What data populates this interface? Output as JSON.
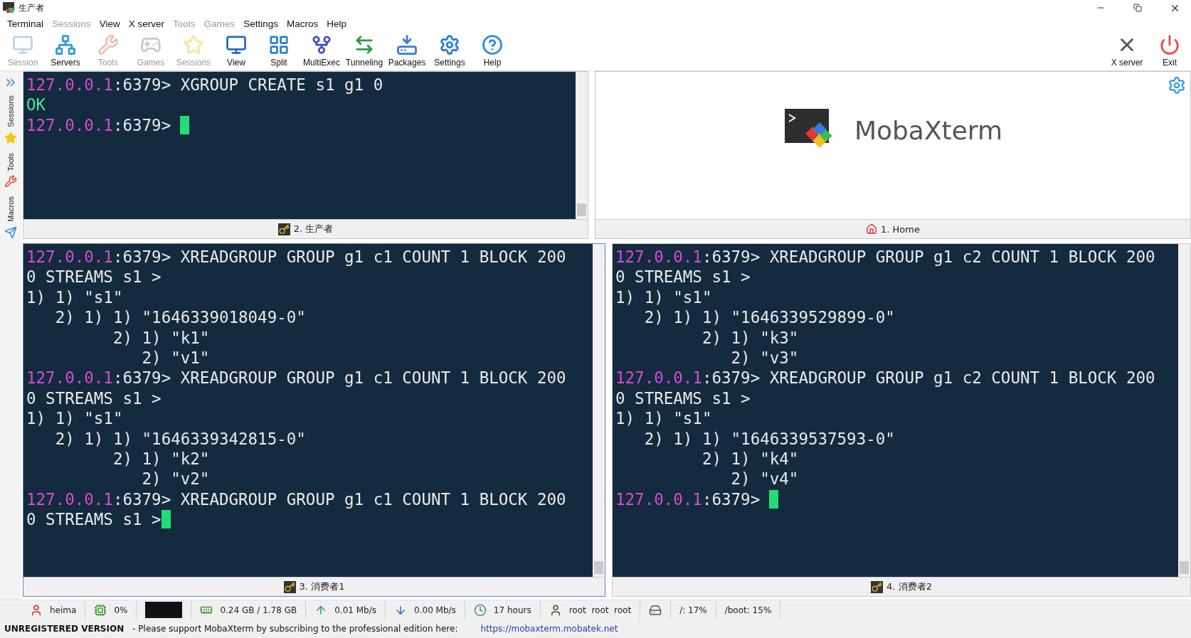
{
  "window": {
    "title": "生产者"
  },
  "menu": [
    {
      "label": "Terminal",
      "disabled": false
    },
    {
      "label": "Sessions",
      "disabled": true
    },
    {
      "label": "View",
      "disabled": false
    },
    {
      "label": "X server",
      "disabled": false
    },
    {
      "label": "Tools",
      "disabled": true
    },
    {
      "label": "Games",
      "disabled": true
    },
    {
      "label": "Settings",
      "disabled": false
    },
    {
      "label": "Macros",
      "disabled": false
    },
    {
      "label": "Help",
      "disabled": false
    }
  ],
  "toolbar": [
    {
      "kind": "session",
      "label": "Session",
      "disabled": true
    },
    {
      "kind": "servers",
      "label": "Servers",
      "disabled": false
    },
    {
      "kind": "tools",
      "label": "Tools",
      "disabled": true
    },
    {
      "kind": "games",
      "label": "Games",
      "disabled": true
    },
    {
      "kind": "sessions",
      "label": "Sessions",
      "disabled": true
    },
    {
      "kind": "view",
      "label": "View",
      "disabled": false
    },
    {
      "kind": "split",
      "label": "Split",
      "disabled": false
    },
    {
      "kind": "multiexec",
      "label": "MultiExec",
      "disabled": false
    },
    {
      "kind": "tunneling",
      "label": "Tunneling",
      "disabled": false
    },
    {
      "kind": "packages",
      "label": "Packages",
      "disabled": false
    },
    {
      "kind": "settings",
      "label": "Settings",
      "disabled": false
    },
    {
      "kind": "help",
      "label": "Help",
      "disabled": false
    }
  ],
  "toolbar_right": [
    {
      "kind": "xserver",
      "label": "X server"
    },
    {
      "kind": "exit",
      "label": "Exit"
    }
  ],
  "sidebar": [
    {
      "kind": "sessions",
      "label": "Sessions"
    },
    {
      "kind": "tools",
      "label": "Tools"
    },
    {
      "kind": "macros",
      "label": "Macros"
    }
  ],
  "panes": [
    {
      "kind": "terminal",
      "tab": "2. 生产者",
      "focused": false,
      "lines": [
        {
          "kind": "prompt",
          "host": "127.0.0.1",
          "port": ":6379>",
          "text": " XGROUP CREATE s1 g1 0",
          "cursor": false
        },
        {
          "kind": "ok",
          "text": "OK"
        },
        {
          "kind": "prompt",
          "host": "127.0.0.1",
          "port": ":6379>",
          "cursor": true
        }
      ]
    },
    {
      "kind": "home",
      "tab": "1. Home",
      "focused": false,
      "brand": "MobaXterm"
    },
    {
      "kind": "terminal",
      "tab": "3. 消费者1",
      "focused": true,
      "lines": [
        {
          "kind": "prompt",
          "host": "127.0.0.1",
          "port": ":6379>",
          "text": " XREADGROUP GROUP g1 c1 COUNT 1 BLOCK 200",
          "cursor": false
        },
        {
          "kind": "text",
          "text": "0 STREAMS s1 >"
        },
        {
          "kind": "text",
          "text": "1) 1) \"s1\""
        },
        {
          "kind": "text",
          "text": "   2) 1) 1) \"1646339018049-0\""
        },
        {
          "kind": "text",
          "text": "         2) 1) \"k1\""
        },
        {
          "kind": "text",
          "text": "            2) \"v1\""
        },
        {
          "kind": "prompt",
          "host": "127.0.0.1",
          "port": ":6379>",
          "text": " XREADGROUP GROUP g1 c1 COUNT 1 BLOCK 200",
          "cursor": false
        },
        {
          "kind": "text",
          "text": "0 STREAMS s1 >"
        },
        {
          "kind": "text",
          "text": "1) 1) \"s1\""
        },
        {
          "kind": "text",
          "text": "   2) 1) 1) \"1646339342815-0\""
        },
        {
          "kind": "text",
          "text": "         2) 1) \"k2\""
        },
        {
          "kind": "text",
          "text": "            2) \"v2\""
        },
        {
          "kind": "prompt",
          "host": "127.0.0.1",
          "port": ":6379>",
          "text": " XREADGROUP GROUP g1 c1 COUNT 1 BLOCK 200",
          "cursor": false
        },
        {
          "kind": "text",
          "text": "0 STREAMS s1 >",
          "cursor": true
        }
      ]
    },
    {
      "kind": "terminal",
      "tab": "4. 消费者2",
      "focused": false,
      "lines": [
        {
          "kind": "prompt",
          "host": "127.0.0.1",
          "port": ":6379>",
          "text": " XREADGROUP GROUP g1 c2 COUNT 1 BLOCK 200",
          "cursor": false
        },
        {
          "kind": "text",
          "text": "0 STREAMS s1 >"
        },
        {
          "kind": "text",
          "text": "1) 1) \"s1\""
        },
        {
          "kind": "text",
          "text": "   2) 1) 1) \"1646339529899-0\""
        },
        {
          "kind": "text",
          "text": "         2) 1) \"k3\""
        },
        {
          "kind": "text",
          "text": "            2) \"v3\""
        },
        {
          "kind": "prompt",
          "host": "127.0.0.1",
          "port": ":6379>",
          "text": " XREADGROUP GROUP g1 c2 COUNT 1 BLOCK 200",
          "cursor": false
        },
        {
          "kind": "text",
          "text": "0 STREAMS s1 >"
        },
        {
          "kind": "text",
          "text": "1) 1) \"s1\""
        },
        {
          "kind": "text",
          "text": "   2) 1) 1) \"1646339537593-0\""
        },
        {
          "kind": "text",
          "text": "         2) 1) \"k4\""
        },
        {
          "kind": "text",
          "text": "            2) \"v4\""
        },
        {
          "kind": "prompt",
          "host": "127.0.0.1",
          "port": ":6379>",
          "cursor": true
        }
      ]
    }
  ],
  "status_bar": [
    {
      "kind": "host",
      "text": "heima"
    },
    {
      "kind": "cpu",
      "text": "0%"
    },
    {
      "kind": "graph"
    },
    {
      "kind": "memory",
      "text": "0.24 GB / 1.78 GB"
    },
    {
      "kind": "upload",
      "text": "0.01 Mb/s"
    },
    {
      "kind": "download",
      "text": "0.00 Mb/s"
    },
    {
      "kind": "uptime",
      "text": "17 hours"
    },
    {
      "kind": "user",
      "text": "root  root  root"
    },
    {
      "kind": "disk"
    },
    {
      "kind": "plain",
      "text": "/: 17%"
    },
    {
      "kind": "plain",
      "text": "/boot: 15%"
    }
  ],
  "footer": {
    "label": "UNREGISTERED VERSION",
    "message": "-  Please support MobaXterm by subscribing to the professional edition here:",
    "link": "https://mobaxterm.mobatek.net"
  }
}
